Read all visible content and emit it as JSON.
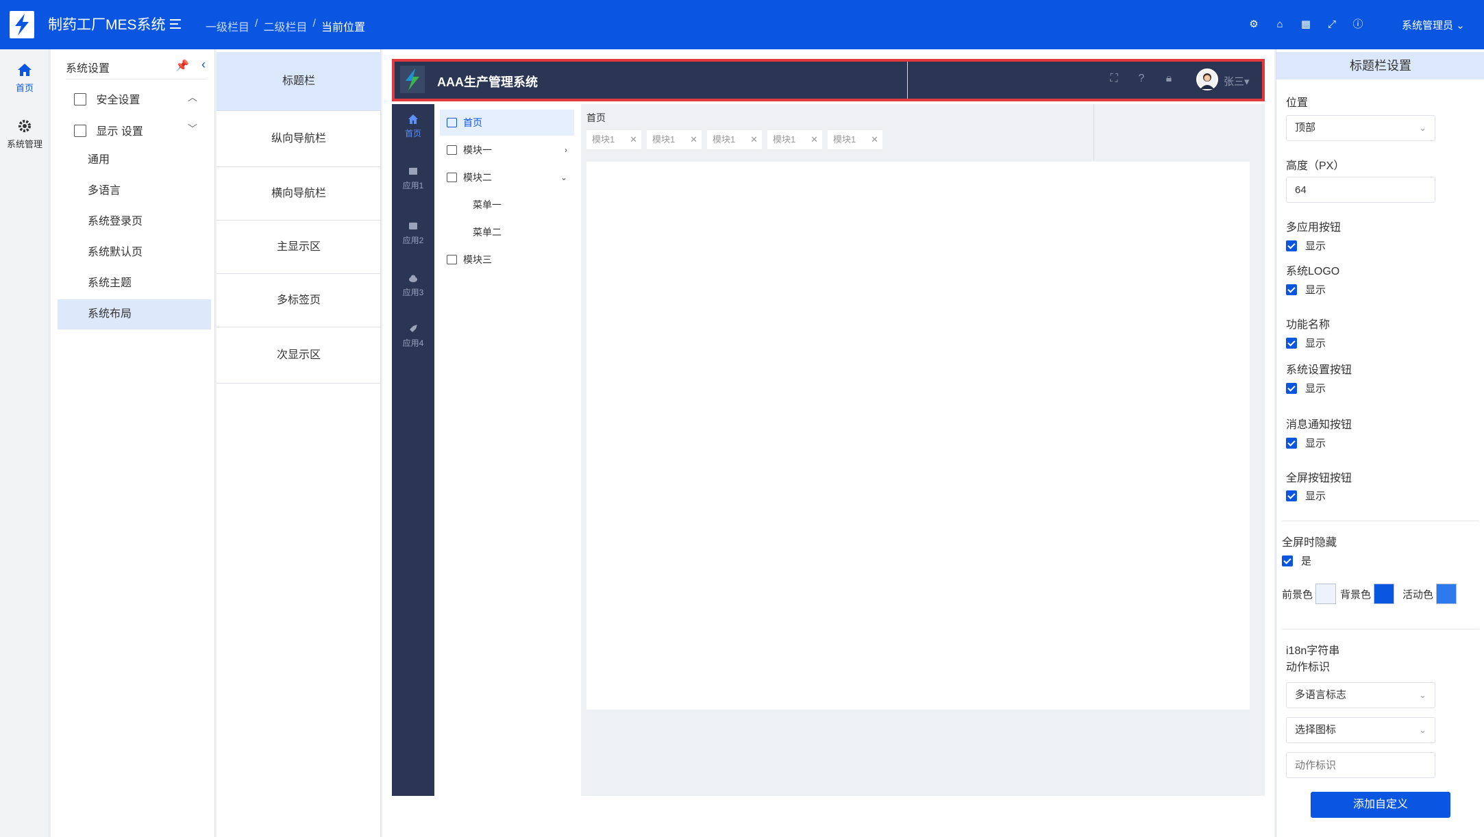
{
  "app": {
    "title": "制药工厂MES系统",
    "breadcrumb": [
      "一级栏目",
      "二级栏目",
      "当前位置"
    ],
    "user": "系统管理员",
    "brand_color": "#0a56e0"
  },
  "rail": {
    "items": [
      {
        "label": "首页",
        "icon": "home-icon"
      },
      {
        "label": "系统管理",
        "icon": "gear-icon"
      }
    ]
  },
  "menu": {
    "title": "系统设置",
    "groups": [
      {
        "label": "安全设置",
        "icon": "save-icon"
      },
      {
        "label": "显示 设置",
        "icon": "document-icon"
      }
    ],
    "items": [
      "通用",
      "多语言",
      "系统登录页",
      "系统默认页",
      "系统主题",
      "系统布局"
    ],
    "active": "系统布局"
  },
  "sections": {
    "items": [
      "标题栏",
      "纵向导航栏",
      "横向导航栏",
      "主显示区",
      "多标签页",
      "次显示区"
    ],
    "active": "标题栏"
  },
  "preview": {
    "title": "AAA生产管理系统",
    "user": "张三",
    "titlebar_color": "#2b3654",
    "highlight_color": "#e0393e",
    "side_nav": [
      "首页",
      "应用1",
      "应用2",
      "应用3",
      "应用4"
    ],
    "menu": {
      "home": "首页",
      "module1": "模块一",
      "module2": "模块二",
      "sub1": "菜单一",
      "sub2": "菜单二",
      "module3": "模块三"
    },
    "crumb": "首页",
    "tabs": [
      "模块1",
      "模块1",
      "模块1",
      "模块1",
      "模块1"
    ],
    "tab_close": "✕"
  },
  "config": {
    "title": "标题栏设置",
    "position_label": "位置",
    "position_value": "顶部",
    "height_label": "高度（PX）",
    "height_value": "64",
    "multi_app_label": "多应用按钮",
    "logo_label": "系统LOGO",
    "func_name_label": "功能名称",
    "settings_btn_label": "系统设置按钮",
    "notify_btn_label": "消息通知按钮",
    "fullscreen_btn_label": "全屏按钮按钮",
    "show_text": "显示",
    "hide_on_full_label": "全屏时隐藏",
    "yes_text": "是",
    "fg_label": "前景色",
    "bg_label": "背景色",
    "active_label": "活动色",
    "fg_color": "#eef3fb",
    "bg_color": "#0a56e0",
    "active_color": "#2f79ee",
    "i18n_label": "i18n字符串",
    "action_label": "动作标识",
    "i18n_select": "多语言标志",
    "icon_select": "选择图标",
    "action_placeholder": "动作标识",
    "add_button": "添加自定义"
  }
}
